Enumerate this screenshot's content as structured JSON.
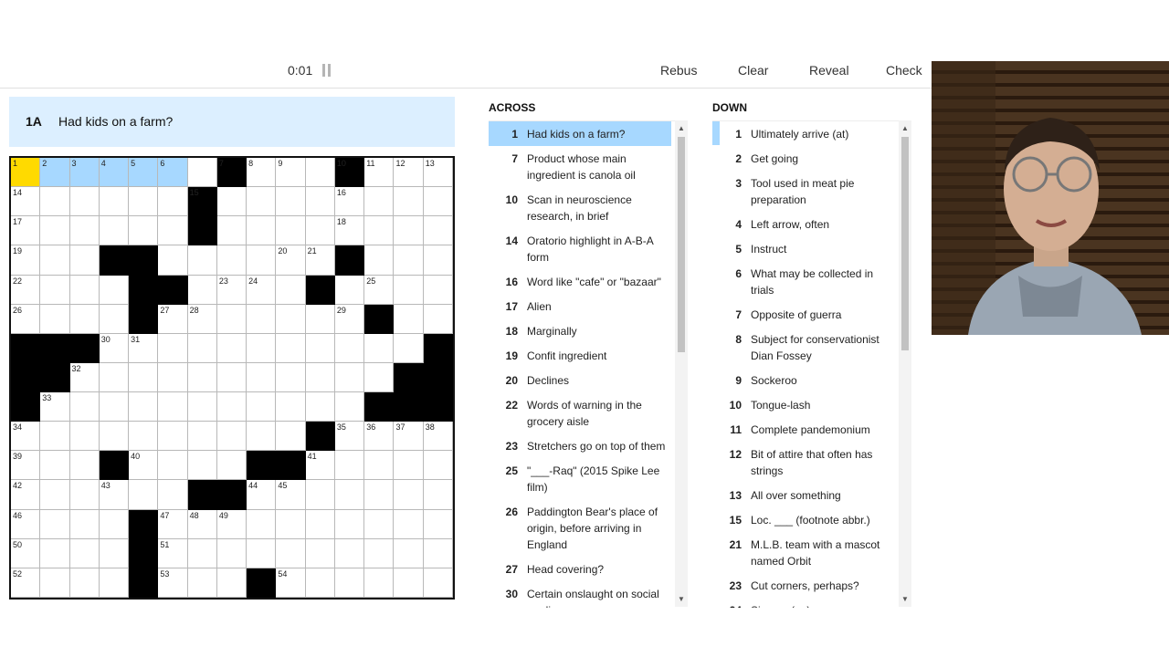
{
  "toolbar": {
    "timer": "0:01",
    "buttons": [
      "Rebus",
      "Clear",
      "Reveal",
      "Check"
    ]
  },
  "current_clue": {
    "label": "1A",
    "text": "Had kids on a farm?"
  },
  "across_title": "ACROSS",
  "down_title": "DOWN",
  "across": [
    {
      "num": "1",
      "text": "Had kids on a farm?",
      "active": true
    },
    {
      "num": "7",
      "text": "Product whose main ingredient is canola oil"
    },
    {
      "num": "10",
      "text": "Scan in neuroscience research, in brief"
    },
    {
      "num": "14",
      "text": "Oratorio highlight in A-B-A form"
    },
    {
      "num": "16",
      "text": "Word like \"cafe\" or \"bazaar\""
    },
    {
      "num": "17",
      "text": "Alien"
    },
    {
      "num": "18",
      "text": "Marginally"
    },
    {
      "num": "19",
      "text": "Confit ingredient"
    },
    {
      "num": "20",
      "text": "Declines"
    },
    {
      "num": "22",
      "text": "Words of warning in the grocery aisle"
    },
    {
      "num": "23",
      "text": "Stretchers go on top of them"
    },
    {
      "num": "25",
      "text": "\"___-Raq\" (2015 Spike Lee film)"
    },
    {
      "num": "26",
      "text": "Paddington Bear's place of origin, before arriving in England"
    },
    {
      "num": "27",
      "text": "Head covering?"
    },
    {
      "num": "30",
      "text": "Certain onslaught on social media"
    }
  ],
  "down": [
    {
      "num": "1",
      "text": "Ultimately arrive (at)"
    },
    {
      "num": "2",
      "text": "Get going"
    },
    {
      "num": "3",
      "text": "Tool used in meat pie preparation"
    },
    {
      "num": "4",
      "text": "Left arrow, often"
    },
    {
      "num": "5",
      "text": "Instruct"
    },
    {
      "num": "6",
      "text": "What may be collected in trials"
    },
    {
      "num": "7",
      "text": "Opposite of guerra"
    },
    {
      "num": "8",
      "text": "Subject for conservationist Dian Fossey"
    },
    {
      "num": "9",
      "text": "Sockeroo"
    },
    {
      "num": "10",
      "text": "Tongue-lash"
    },
    {
      "num": "11",
      "text": "Complete pandemonium"
    },
    {
      "num": "12",
      "text": "Bit of attire that often has strings"
    },
    {
      "num": "13",
      "text": "All over something"
    },
    {
      "num": "15",
      "text": "Loc. ___ (footnote abbr.)"
    },
    {
      "num": "21",
      "text": "M.L.B. team with a mascot named Orbit"
    },
    {
      "num": "23",
      "text": "Cut corners, perhaps?"
    },
    {
      "num": "24",
      "text": "Sign up (up)"
    }
  ],
  "grid": {
    "rows": [
      ".......#...#....",
      "......#.........",
      "......#.........",
      "...##......#....",
      "....##....#.....",
      "....#.......#...",
      "###...........#.",
      "##...........##.",
      "#...........###.",
      "..........#.....",
      "...#....##......",
      "......##........",
      "....#...........",
      "....#...........",
      "....#...#......."
    ],
    "numbers": [
      [
        0,
        0,
        "1"
      ],
      [
        0,
        1,
        "2"
      ],
      [
        0,
        2,
        "3"
      ],
      [
        0,
        3,
        "4"
      ],
      [
        0,
        4,
        "5"
      ],
      [
        0,
        5,
        "6"
      ],
      [
        0,
        7,
        "7"
      ],
      [
        0,
        8,
        "8"
      ],
      [
        0,
        9,
        "9"
      ],
      [
        0,
        11,
        "10"
      ],
      [
        0,
        12,
        "11"
      ],
      [
        0,
        13,
        "12"
      ],
      [
        0,
        14,
        "13"
      ],
      [
        1,
        0,
        "14"
      ],
      [
        1,
        6,
        "15"
      ],
      [
        1,
        11,
        "16"
      ],
      [
        2,
        0,
        "17"
      ],
      [
        2,
        11,
        "18"
      ],
      [
        3,
        0,
        "19"
      ],
      [
        3,
        9,
        "20"
      ],
      [
        3,
        10,
        "21"
      ],
      [
        4,
        0,
        "22"
      ],
      [
        4,
        7,
        "23"
      ],
      [
        4,
        8,
        "24"
      ],
      [
        4,
        12,
        "25"
      ],
      [
        5,
        0,
        "26"
      ],
      [
        5,
        5,
        "27"
      ],
      [
        5,
        6,
        "28"
      ],
      [
        5,
        11,
        "29"
      ],
      [
        6,
        3,
        "30"
      ],
      [
        6,
        4,
        "31"
      ],
      [
        7,
        2,
        "32"
      ],
      [
        8,
        1,
        "33"
      ],
      [
        9,
        0,
        "34"
      ],
      [
        9,
        11,
        "35"
      ],
      [
        9,
        12,
        "36"
      ],
      [
        9,
        13,
        "37"
      ],
      [
        9,
        14,
        "38"
      ],
      [
        10,
        0,
        "39"
      ],
      [
        10,
        4,
        "40"
      ],
      [
        10,
        10,
        "41"
      ],
      [
        11,
        0,
        "42"
      ],
      [
        11,
        3,
        "43"
      ],
      [
        11,
        8,
        "44"
      ],
      [
        11,
        9,
        "45"
      ],
      [
        12,
        0,
        "46"
      ],
      [
        12,
        5,
        "47"
      ],
      [
        12,
        6,
        "48"
      ],
      [
        12,
        7,
        "49"
      ],
      [
        13,
        0,
        "50"
      ],
      [
        13,
        5,
        "51"
      ],
      [
        14,
        0,
        "52"
      ],
      [
        14,
        5,
        "53"
      ],
      [
        14,
        9,
        "54"
      ]
    ],
    "selected": [
      0,
      0
    ],
    "highlighted": [
      [
        0,
        1
      ],
      [
        0,
        2
      ],
      [
        0,
        3
      ],
      [
        0,
        4
      ],
      [
        0,
        5
      ]
    ]
  },
  "colors": {
    "highlight": "#a7d8ff",
    "selected": "#ffda00",
    "clue_bar": "#dcefff"
  }
}
